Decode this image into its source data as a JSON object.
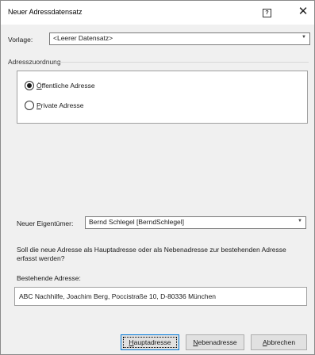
{
  "window": {
    "title": "Neuer Adressdatensatz",
    "help_icon": "?",
    "close_icon": "✕"
  },
  "template": {
    "label": "Vorlage:",
    "value": "<Leerer Datensatz>"
  },
  "assignment": {
    "group_title": "Adresszuordnung",
    "options": [
      {
        "accel": "Ö",
        "rest": "ffentliche Adresse",
        "selected": true
      },
      {
        "accel": "P",
        "rest": "rivate Adresse",
        "selected": false
      }
    ]
  },
  "owner": {
    "label": "Neuer Eigentümer:",
    "value": "Bernd Schlegel [BerndSchlegel]"
  },
  "question": "Soll die neue Adresse als Hauptadresse oder als Nebenadresse zur bestehenden Adresse erfasst werden?",
  "existing": {
    "label": "Bestehende Adresse:",
    "value": "ABC Nachhilfe, Joachim Berg, Poccistraße 10, D-80336 München"
  },
  "buttons": {
    "main": {
      "accel": "H",
      "rest": "auptadresse"
    },
    "secondary": {
      "accel": "N",
      "rest": "ebenadresse"
    },
    "cancel": {
      "accel": "A",
      "rest": "bbrechen"
    }
  },
  "dropdown_arrow": "▼"
}
